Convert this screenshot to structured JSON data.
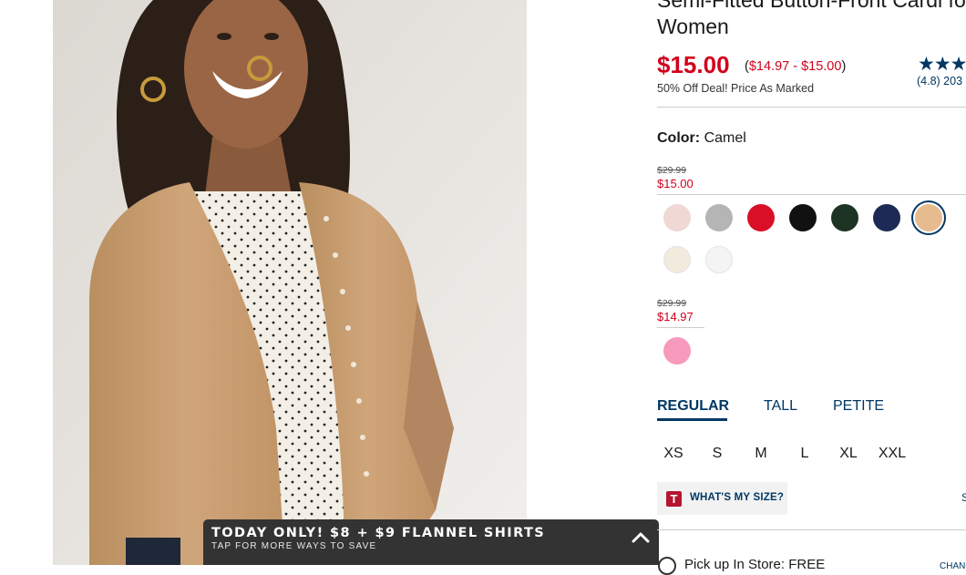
{
  "product": {
    "title_line1": "Semi-Fitted Button-Front Cardi for",
    "title_line2": "Women",
    "price": "$15.00",
    "price_range": "$14.97 - $15.00",
    "price_range_open": "(",
    "price_range_close": ")",
    "deal_text": "50% Off Deal! Price As Marked",
    "stars": "★★★",
    "rating_text": "(4.8) 203"
  },
  "color": {
    "label": "Color:",
    "value": "Camel",
    "groups": [
      {
        "was": "$29.99",
        "now": "$15.00",
        "swatches": [
          {
            "name": "blush",
            "hex": "#f0d8d4"
          },
          {
            "name": "heather-gray",
            "hex": "#b5b5b5"
          },
          {
            "name": "red",
            "hex": "#d80f26"
          },
          {
            "name": "black",
            "hex": "#111111"
          },
          {
            "name": "dark-green",
            "hex": "#1d3324"
          },
          {
            "name": "navy",
            "hex": "#1d2a55"
          },
          {
            "name": "camel",
            "hex": "#e7bb90",
            "selected": true
          },
          {
            "name": "cream",
            "hex": "#f2ebdd"
          },
          {
            "name": "white",
            "hex": "#f4f4f4"
          }
        ]
      },
      {
        "was": "$29.99",
        "now": "$14.97",
        "swatches": [
          {
            "name": "pink",
            "hex": "#f79abc"
          }
        ]
      }
    ]
  },
  "fit_tabs": [
    {
      "label": "REGULAR",
      "active": true
    },
    {
      "label": "TALL",
      "active": false
    },
    {
      "label": "PETITE",
      "active": false
    }
  ],
  "sizes": [
    "XS",
    "S",
    "M",
    "L",
    "XL",
    "XXL"
  ],
  "size_help": {
    "logo_letter": "T",
    "label": "WHAT'S MY SIZE?",
    "edge_link": "S"
  },
  "pickup": {
    "text": "Pick up In Store: FREE",
    "action": "CHANG"
  },
  "promo": {
    "title": "TODAY ONLY! $8 + $9 FLANNEL SHIRTS",
    "subtitle": "TAP FOR MORE WAYS TO SAVE"
  },
  "colors": {
    "price_red": "#d1001c",
    "link_navy": "#003764",
    "banner_bg": "#333333",
    "wms_logo": "#b5152f"
  },
  "icons": {
    "promo_toggle": "chevron-up-icon",
    "size_help": "wms-logo-icon",
    "rating": "star-icon"
  }
}
